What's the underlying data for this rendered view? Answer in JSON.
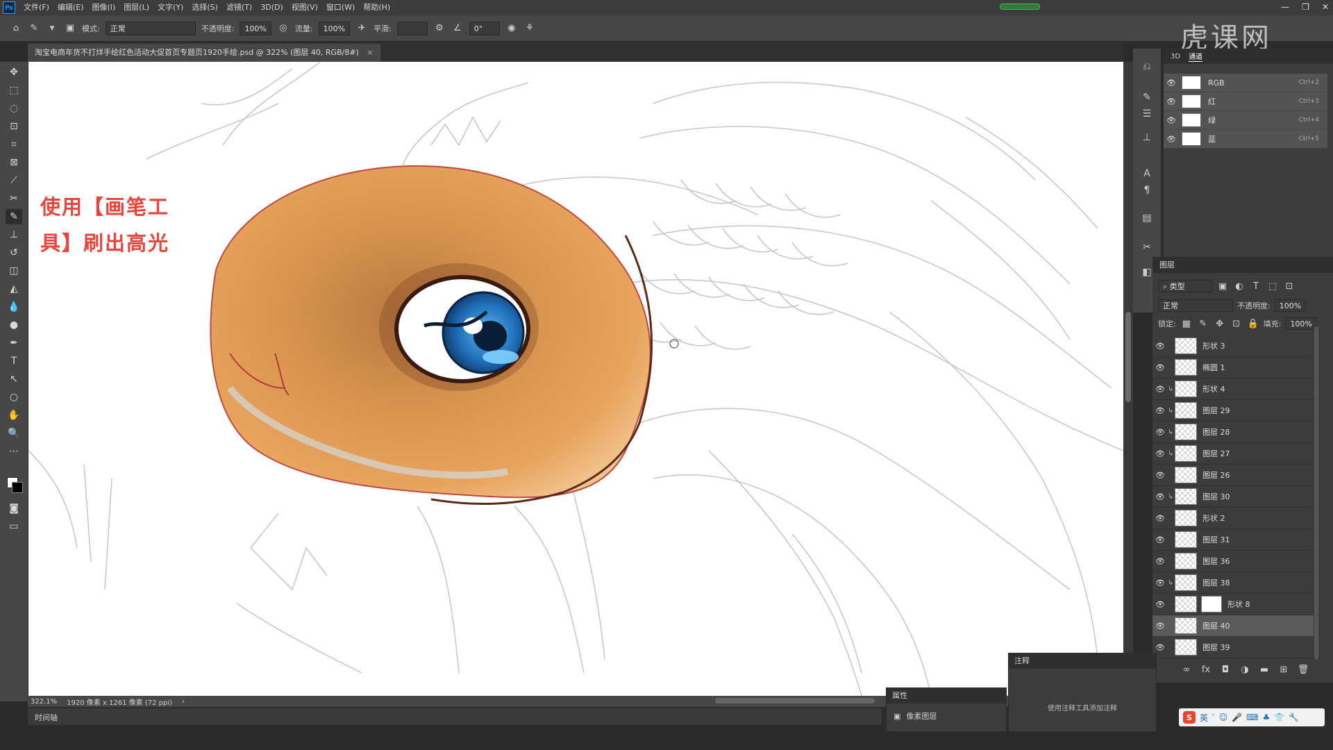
{
  "app": {
    "logo": "Ps"
  },
  "menu": [
    "文件(F)",
    "编辑(E)",
    "图像(I)",
    "图层(L)",
    "文字(Y)",
    "选择(S)",
    "滤镜(T)",
    "3D(D)",
    "视图(V)",
    "窗口(W)",
    "帮助(H)"
  ],
  "window_controls": [
    "—",
    "❐",
    "✕"
  ],
  "options": {
    "mode_label": "模式:",
    "mode_value": "正常",
    "opacity_label": "不透明度:",
    "opacity_value": "100%",
    "flow_label": "流量:",
    "flow_value": "100%",
    "smooth_label": "平滑:",
    "angle_value": "0°"
  },
  "document": {
    "tab_title": "淘宝电商年货不打烊手绘红色活动大促首页专题页1920手绘.psd @ 322% (图层 40, RGB/8#)"
  },
  "caption": {
    "line1": "使用【画笔工",
    "line2": "具】刷出高光"
  },
  "status": {
    "zoom": "322.1%",
    "doc_size": "1920 像素 x 1261 像素 (72 ppi)"
  },
  "timeline_label": "时间轴",
  "channels_panel": {
    "tabs": [
      "3D",
      "通道"
    ],
    "rows": [
      {
        "name": "RGB",
        "shortcut": "Ctrl+2"
      },
      {
        "name": "红",
        "shortcut": "Ctrl+3"
      },
      {
        "name": "绿",
        "shortcut": "Ctrl+4"
      },
      {
        "name": "蓝",
        "shortcut": "Ctrl+5"
      }
    ]
  },
  "layers_panel": {
    "title": "图层",
    "filter": "类型",
    "blend": "正常",
    "opacity_label": "不透明度:",
    "opacity_value": "100%",
    "lock_label": "锁定:",
    "fill_label": "填充:",
    "fill_value": "100%",
    "layers": [
      {
        "name": "形状 3",
        "selected": false
      },
      {
        "name": "椭圆 1",
        "selected": false
      },
      {
        "name": "形状 4",
        "selected": false
      },
      {
        "name": "图层 29",
        "selected": false
      },
      {
        "name": "图层 28",
        "selected": false
      },
      {
        "name": "图层 27",
        "selected": false
      },
      {
        "name": "图层 26",
        "selected": false
      },
      {
        "name": "图层 30",
        "selected": false
      },
      {
        "name": "形状 2",
        "selected": false
      },
      {
        "name": "图层 31",
        "selected": false
      },
      {
        "name": "图层 36",
        "selected": false
      },
      {
        "name": "图层 38",
        "selected": false
      },
      {
        "name": "形状 8",
        "selected": false
      },
      {
        "name": "图层 40",
        "selected": true
      },
      {
        "name": "图层 39",
        "selected": false
      }
    ]
  },
  "properties_panel": {
    "title": "属性",
    "kind": "像素图层"
  },
  "notes_panel": {
    "title": "注释",
    "hint": "使用注释工具添加注释"
  },
  "ime": {
    "label": "英"
  },
  "watermark": "虎课网"
}
